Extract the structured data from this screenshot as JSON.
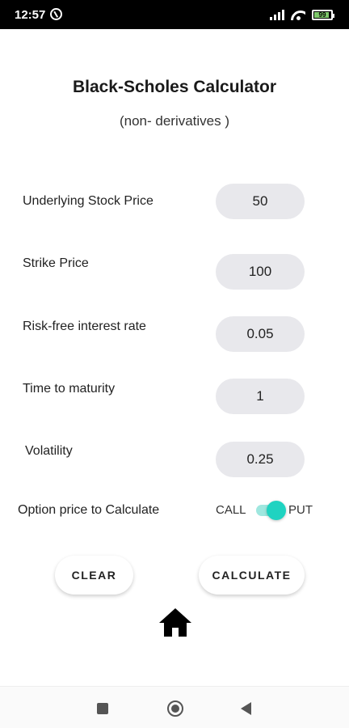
{
  "status_bar": {
    "time": "12:57",
    "battery_level": "99",
    "icons": [
      "app-notification-icon",
      "signal-icon",
      "wifi-icon",
      "battery-icon"
    ]
  },
  "header": {
    "title": "Black-Scholes Calculator",
    "subtitle": "(non- derivatives )"
  },
  "fields": [
    {
      "label": "Underlying Stock Price",
      "value": "50"
    },
    {
      "label": "Strike Price",
      "value": "100"
    },
    {
      "label": "Risk-free interest rate",
      "value": "0.05"
    },
    {
      "label": "Time to maturity",
      "value": "1"
    },
    {
      "label": "Volatility",
      "value": "0.25"
    }
  ],
  "option_selector": {
    "label": "Option price to Calculate",
    "left_option": "CALL",
    "right_option": "PUT",
    "selected": "PUT",
    "accent_color": "#1fd3c1"
  },
  "buttons": {
    "clear": "CLEAR",
    "calculate": "CALCULATE"
  },
  "bottom_icon": "home-icon",
  "nav_bar": {
    "icons": [
      "recents-square-icon",
      "home-circle-icon",
      "back-triangle-icon"
    ]
  }
}
